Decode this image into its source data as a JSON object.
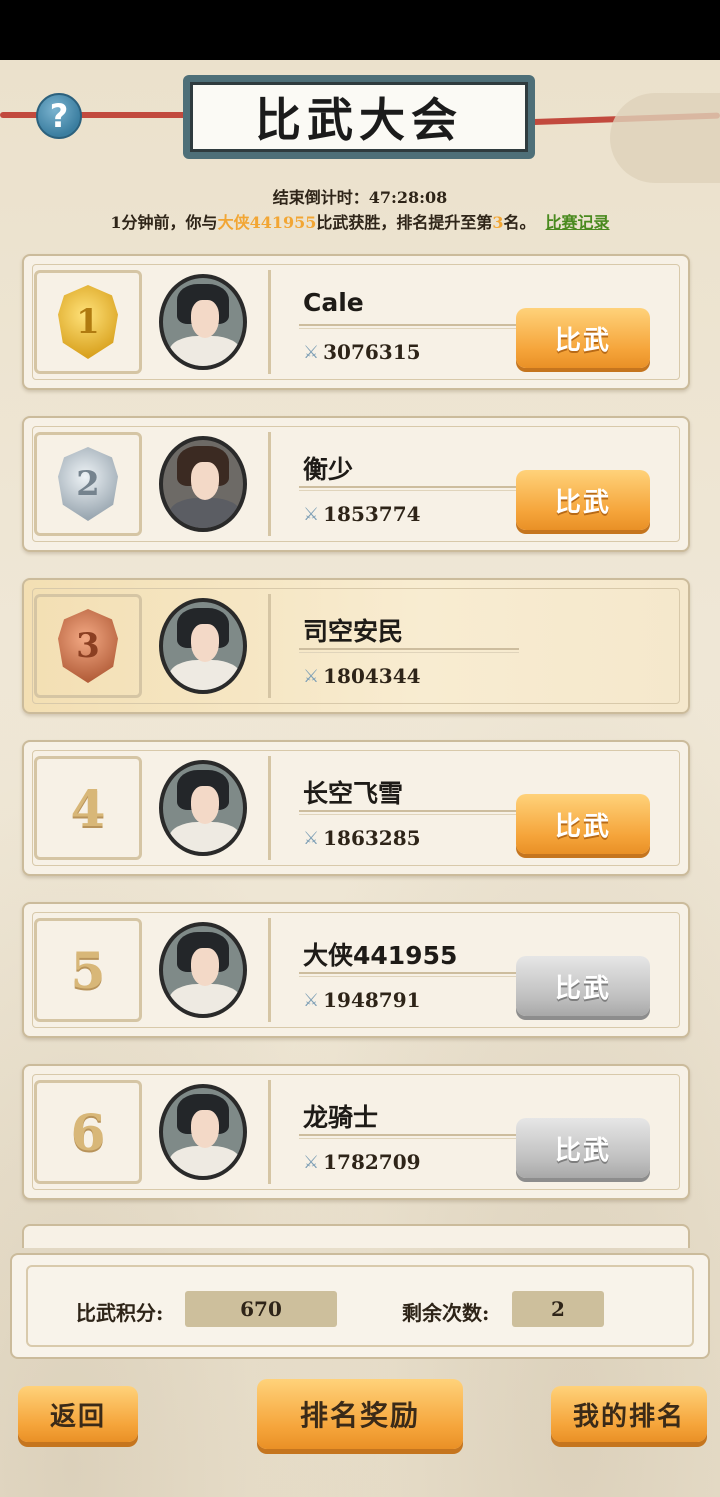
{
  "header": {
    "title": "比武大会",
    "help_icon": "?"
  },
  "countdown": {
    "label": "结束倒计时：",
    "time": "47:28:08"
  },
  "notice": {
    "prefix": "1分钟前，你与",
    "opponent": "大侠441955",
    "middle": "比武获胜，排名提升至第",
    "rank": "3",
    "suffix": "名。",
    "record_link": "比赛记录"
  },
  "players": [
    {
      "rank": "1",
      "name": "Cale",
      "power": "3076315",
      "button": "比武",
      "medal": "gold",
      "button_enabled": true
    },
    {
      "rank": "2",
      "name": "衡少",
      "power": "1853774",
      "button": "比武",
      "medal": "silver",
      "button_enabled": true
    },
    {
      "rank": "3",
      "name": "司空安民",
      "power": "1804344",
      "button": "",
      "medal": "bronze",
      "is_self": true
    },
    {
      "rank": "4",
      "name": "长空飞雪",
      "power": "1863285",
      "button": "比武",
      "button_enabled": true
    },
    {
      "rank": "5",
      "name": "大侠441955",
      "power": "1948791",
      "button": "比武",
      "button_enabled": false
    },
    {
      "rank": "6",
      "name": "龙骑士",
      "power": "1782709",
      "button": "比武",
      "button_enabled": false
    }
  ],
  "stats": {
    "points_label": "比武积分:",
    "points_value": "670",
    "remaining_label": "剩余次数:",
    "remaining_value": "2"
  },
  "buttons": {
    "back": "返回",
    "rank_rewards": "排名奖励",
    "my_rank": "我的排名"
  },
  "colors": {
    "accent_orange": "#f5a43a",
    "highlight_text": "#f2a634",
    "link_green": "#4a8a1f"
  }
}
